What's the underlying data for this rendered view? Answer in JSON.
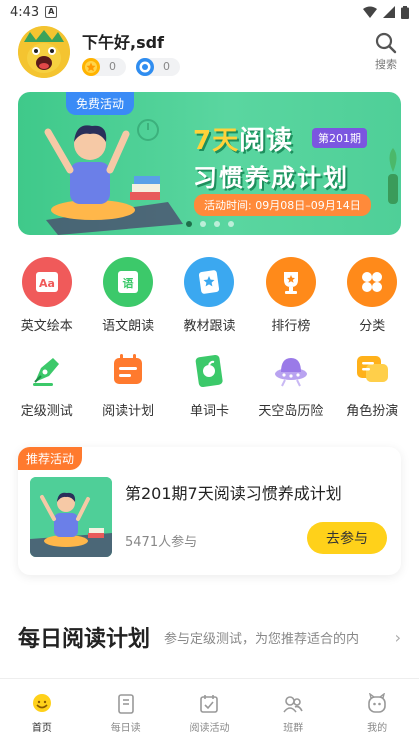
{
  "status_bar": {
    "time": "4:43"
  },
  "header": {
    "greeting": "下午好,sdf",
    "badge1_count": "0",
    "badge2_count": "0",
    "search_label": "搜索"
  },
  "banner": {
    "tag": "免费活动",
    "title_seven": "7天",
    "title_rest": "阅读",
    "issue": "第201期",
    "subtitle": "习惯养成计划",
    "time": "活动时间: 09月08日–09月14日"
  },
  "features": [
    {
      "label": "英文绘本",
      "icon": "english-picturebook-icon",
      "color": "#f05a5a"
    },
    {
      "label": "语文朗读",
      "icon": "chinese-reading-icon",
      "color": "#3cc96a"
    },
    {
      "label": "教材跟读",
      "icon": "textbook-followread-icon",
      "color": "#3ba8f0"
    },
    {
      "label": "排行榜",
      "icon": "trophy-icon",
      "color": "#ff8a1a"
    },
    {
      "label": "分类",
      "icon": "category-icon",
      "color": "#ff8a1a"
    },
    {
      "label": "定级测试",
      "icon": "pen-icon",
      "color": "#3cc96a"
    },
    {
      "label": "阅读计划",
      "icon": "calendar-plan-icon",
      "color": "#ff7a2e"
    },
    {
      "label": "单词卡",
      "icon": "apple-card-icon",
      "color": "#3cc96a"
    },
    {
      "label": "天空岛历险",
      "icon": "ufo-icon",
      "color": "#9a7ae8"
    },
    {
      "label": "角色扮演",
      "icon": "chat-bubble-icon",
      "color": "#ffb11a"
    }
  ],
  "recommend": {
    "tag": "推荐活动",
    "title": "第201期7天阅读习惯养成计划",
    "participants": "5471人参与",
    "join_label": "去参与"
  },
  "daily": {
    "title": "每日阅读计划",
    "subtitle": "参与定级测试，为您推荐适合的内"
  },
  "tabs": [
    {
      "label": "首页",
      "icon": "home-icon",
      "active": true
    },
    {
      "label": "每日读",
      "icon": "daily-read-icon",
      "active": false
    },
    {
      "label": "阅读活动",
      "icon": "reading-activity-icon",
      "active": false
    },
    {
      "label": "班群",
      "icon": "class-group-icon",
      "active": false
    },
    {
      "label": "我的",
      "icon": "profile-icon",
      "active": false
    }
  ]
}
